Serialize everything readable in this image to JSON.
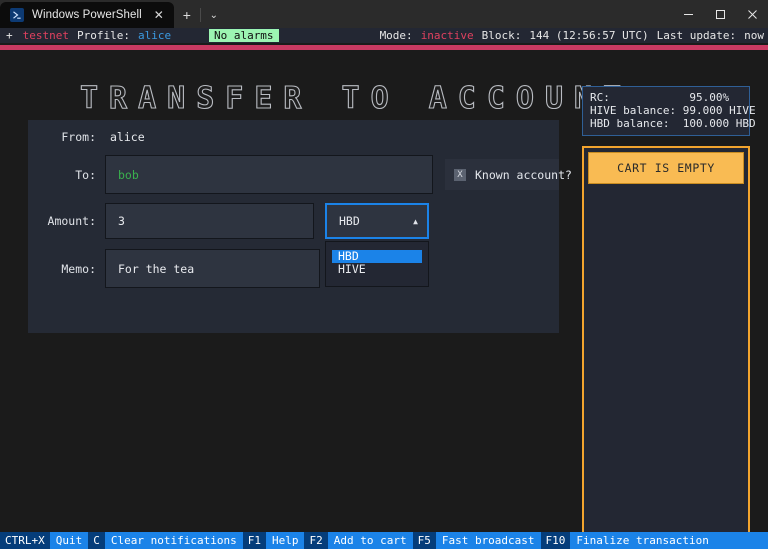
{
  "window": {
    "tab_title": "Windows PowerShell",
    "tab_icon": "powershell-icon",
    "close_glyph": "✕",
    "new_tab_glyph": "+",
    "tab_menu_glyph": "⌄",
    "minimize_glyph": "─",
    "maximize_glyph": "□",
    "window_close_glyph": "✕"
  },
  "statusline": {
    "plus": "+",
    "network": "testnet",
    "profile_label": "Profile:",
    "profile_value": "alice",
    "alarms": "No alarms",
    "mode_label": "Mode:",
    "mode_value": "inactive",
    "block_label": "Block:",
    "block_value": "144 (12:56:57 UTC)",
    "last_update_label": "Last update:",
    "last_update_value": "now",
    "accent_pink": "#c93a63",
    "alarm_green": "#9cf5b2"
  },
  "title": "TRANSFER TO ACCOUNT",
  "form": {
    "from_label": "From:",
    "from_value": "alice",
    "to_label": "To:",
    "to_value": "bob",
    "to_placeholder": "bob",
    "known_account_label": "Known account?",
    "known_account_checked_glyph": "X",
    "amount_label": "Amount:",
    "amount_value": "3",
    "memo_label": "Memo:",
    "memo_value": "For the tea",
    "currency": {
      "selected": "HBD",
      "caret": "▲",
      "options": [
        "HBD",
        "HIVE"
      ],
      "highlight_color": "#1b83e8"
    }
  },
  "rc_panel": {
    "rc_line": "RC:            95.00%",
    "hive_line": "HIVE balance: 99.000 HIVE",
    "hbd_line": "HBD balance:  100.000 HBD",
    "border_color": "#2f5f96"
  },
  "cart": {
    "header": "CART IS EMPTY",
    "border_color": "#f2a42e",
    "header_bg": "#f9bb53"
  },
  "keybar": {
    "items": [
      {
        "key": "CTRL+X",
        "desc": "Quit"
      },
      {
        "key": "C",
        "desc": "Clear notifications"
      },
      {
        "key": "F1",
        "desc": "Help"
      },
      {
        "key": "F2",
        "desc": "Add to cart"
      },
      {
        "key": "F5",
        "desc": "Fast broadcast"
      },
      {
        "key": "F10",
        "desc": "Finalize transaction"
      }
    ],
    "key_bg": "#053d7a",
    "desc_bg": "#1b83e8"
  }
}
